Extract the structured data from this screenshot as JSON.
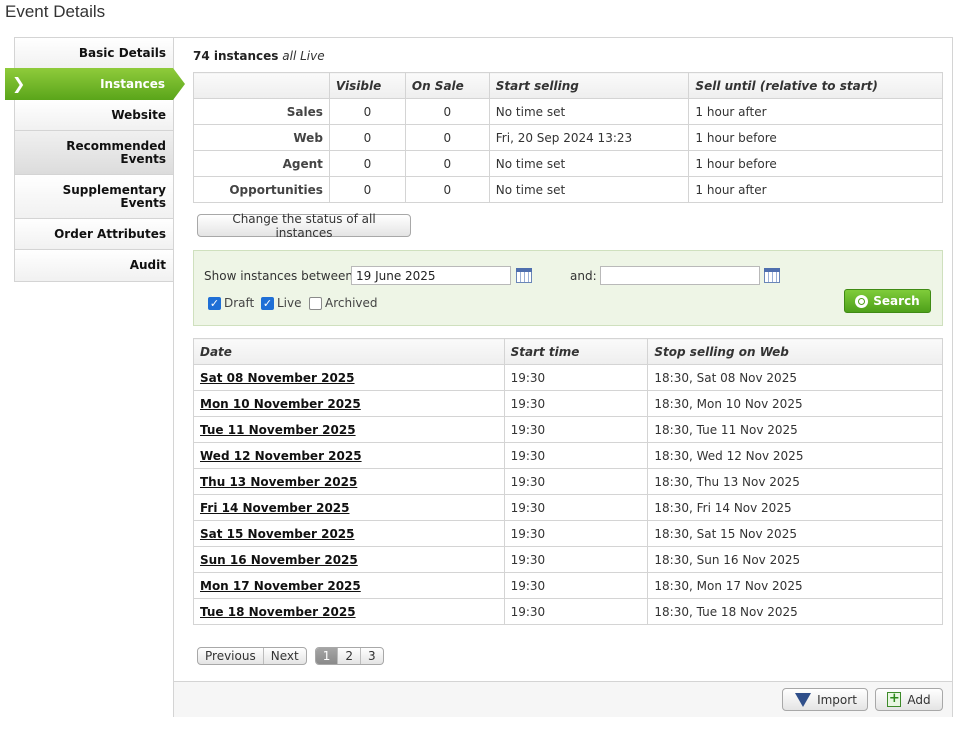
{
  "page": {
    "title": "Event Details"
  },
  "sidebar": {
    "items": [
      {
        "label": "Basic Details"
      },
      {
        "label": "Instances"
      },
      {
        "label": "Website"
      },
      {
        "label": "Recommended Events"
      },
      {
        "label": "Supplementary Events"
      },
      {
        "label": "Order Attributes"
      },
      {
        "label": "Audit"
      }
    ],
    "active_index": 1
  },
  "summary": {
    "count": "74 instances",
    "qualifier": "all Live"
  },
  "status_table": {
    "headers": [
      "",
      "Visible",
      "On Sale",
      "Start selling",
      "Sell until (relative to start)"
    ],
    "rows": [
      {
        "label": "Sales",
        "visible": "0",
        "on_sale": "0",
        "start": "No time set",
        "until": "1 hour after"
      },
      {
        "label": "Web",
        "visible": "0",
        "on_sale": "0",
        "start": "Fri, 20 Sep 2024 13:23",
        "until": "1 hour before"
      },
      {
        "label": "Agent",
        "visible": "0",
        "on_sale": "0",
        "start": "No time set",
        "until": "1 hour before"
      },
      {
        "label": "Opportunities",
        "visible": "0",
        "on_sale": "0",
        "start": "No time set",
        "until": "1 hour after"
      }
    ]
  },
  "change_status_label": "Change the status of all instances",
  "filter": {
    "between_label": "Show instances between:",
    "from_value": "19 June 2025",
    "and_label": "and:",
    "to_value": "",
    "draft_label": "Draft",
    "live_label": "Live",
    "archived_label": "Archived",
    "draft_checked": true,
    "live_checked": true,
    "archived_checked": false,
    "search_label": "Search"
  },
  "instances": {
    "headers": [
      "Date",
      "Start time",
      "Stop selling on Web"
    ],
    "rows": [
      {
        "date": "Sat 08 November 2025",
        "time": "19:30",
        "stop": "18:30, Sat 08 Nov 2025"
      },
      {
        "date": "Mon 10 November 2025",
        "time": "19:30",
        "stop": "18:30, Mon 10 Nov 2025"
      },
      {
        "date": "Tue 11 November 2025",
        "time": "19:30",
        "stop": "18:30, Tue 11 Nov 2025"
      },
      {
        "date": "Wed 12 November 2025",
        "time": "19:30",
        "stop": "18:30, Wed 12 Nov 2025"
      },
      {
        "date": "Thu 13 November 2025",
        "time": "19:30",
        "stop": "18:30, Thu 13 Nov 2025"
      },
      {
        "date": "Fri 14 November 2025",
        "time": "19:30",
        "stop": "18:30, Fri 14 Nov 2025"
      },
      {
        "date": "Sat 15 November 2025",
        "time": "19:30",
        "stop": "18:30, Sat 15 Nov 2025"
      },
      {
        "date": "Sun 16 November 2025",
        "time": "19:30",
        "stop": "18:30, Sun 16 Nov 2025"
      },
      {
        "date": "Mon 17 November 2025",
        "time": "19:30",
        "stop": "18:30, Mon 17 Nov 2025"
      },
      {
        "date": "Tue 18 November 2025",
        "time": "19:30",
        "stop": "18:30, Tue 18 Nov 2025"
      }
    ]
  },
  "pager": {
    "previous": "Previous",
    "next": "Next",
    "pages": [
      "1",
      "2",
      "3"
    ],
    "current": "1"
  },
  "footer": {
    "import_label": "Import",
    "add_label": "Add"
  },
  "icons": {
    "active_marker": "chevron-right-icon",
    "calendar": "calendar-icon",
    "search": "search-icon",
    "import": "import-icon",
    "add": "add-icon"
  },
  "colors": {
    "accent": "#5aa51a",
    "filter_bg": "#eef5e6",
    "checkbox": "#1f6fd6"
  }
}
